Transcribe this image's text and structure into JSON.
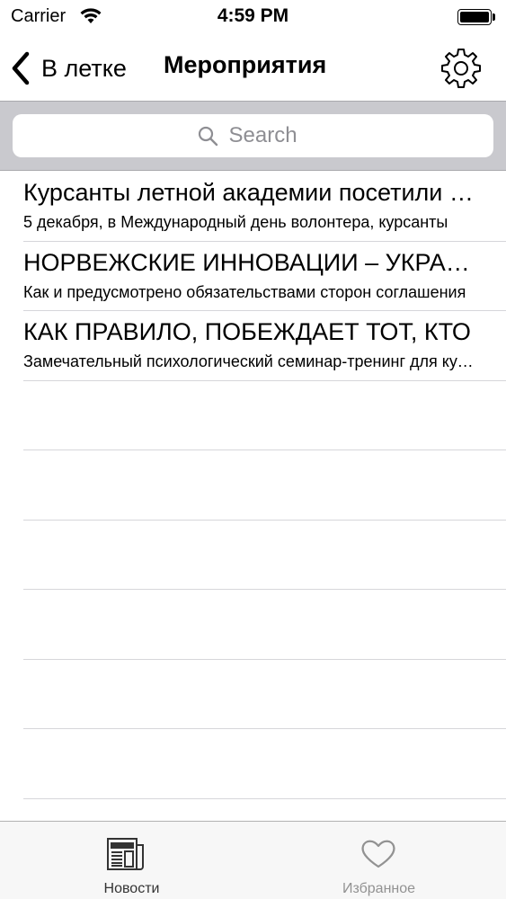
{
  "status_bar": {
    "carrier": "Carrier",
    "time": "4:59 PM"
  },
  "nav": {
    "back_label": "В летке",
    "title": "Мероприятия",
    "settings_icon": "gear-icon"
  },
  "search": {
    "placeholder": "Search"
  },
  "items": [
    {
      "title": "Курсанты летной академии посетили дом-интернат",
      "subtitle": "5 декабря, в Международный день волонтера, курсанты"
    },
    {
      "title": "НОРВЕЖСКИЕ ИННОВАЦИИ – УКРАИНСКОЙ АВИАЦИИ",
      "subtitle": "Как и предусмотрено обязательствами сторон соглашения"
    },
    {
      "title": "КАК ПРАВИЛО, ПОБЕЖДАЕТ ТОТ, КТО",
      "subtitle": "Замечательный психологический семинар-тренинг для курсантов"
    }
  ],
  "tabs": {
    "news_label": "Новости",
    "favorites_label": "Избранное",
    "active_color": "#333333",
    "inactive_color": "#929292"
  }
}
